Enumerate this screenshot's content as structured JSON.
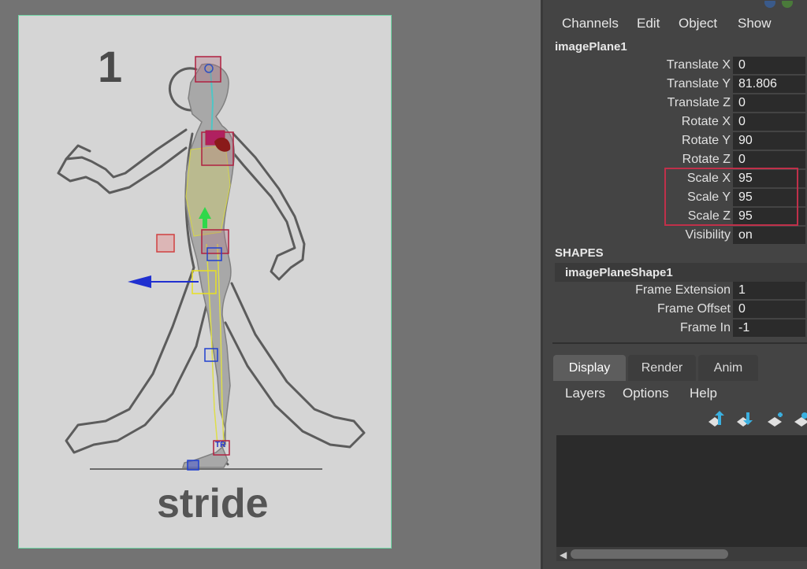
{
  "viewport": {
    "plane_number": "1",
    "caption": "stride",
    "manipulator_labels": {
      "ankle_marker": "TR"
    }
  },
  "channel_box": {
    "menu": [
      "Channels",
      "Edit",
      "Object",
      "Show"
    ],
    "node_name": "imagePlane1",
    "attributes": [
      {
        "label": "Translate X",
        "value": "0"
      },
      {
        "label": "Translate Y",
        "value": "81.806"
      },
      {
        "label": "Translate Z",
        "value": "0"
      },
      {
        "label": "Rotate X",
        "value": "0"
      },
      {
        "label": "Rotate Y",
        "value": "90"
      },
      {
        "label": "Rotate Z",
        "value": "0"
      },
      {
        "label": "Scale X",
        "value": "95"
      },
      {
        "label": "Scale Y",
        "value": "95"
      },
      {
        "label": "Scale Z",
        "value": "95"
      },
      {
        "label": "Visibility",
        "value": "on"
      }
    ],
    "shapes_title": "SHAPES",
    "shape_name": "imagePlaneShape1",
    "shape_attributes": [
      {
        "label": "Frame Extension",
        "value": "1"
      },
      {
        "label": "Frame Offset",
        "value": "0"
      },
      {
        "label": "Frame In",
        "value": "-1"
      }
    ]
  },
  "layer_editor": {
    "tabs": [
      "Display",
      "Render",
      "Anim"
    ],
    "active_tab": "Display",
    "menu": [
      "Layers",
      "Options",
      "Help"
    ],
    "tool_icons": [
      "move-layer-up-icon",
      "move-layer-down-icon",
      "new-layer-icon",
      "new-layer-selected-icon"
    ]
  },
  "colors": {
    "highlight": "#c0304a",
    "plane_border": "#6fd6a5",
    "panel_bg": "#444444",
    "field_bg": "#2b2b2b"
  }
}
